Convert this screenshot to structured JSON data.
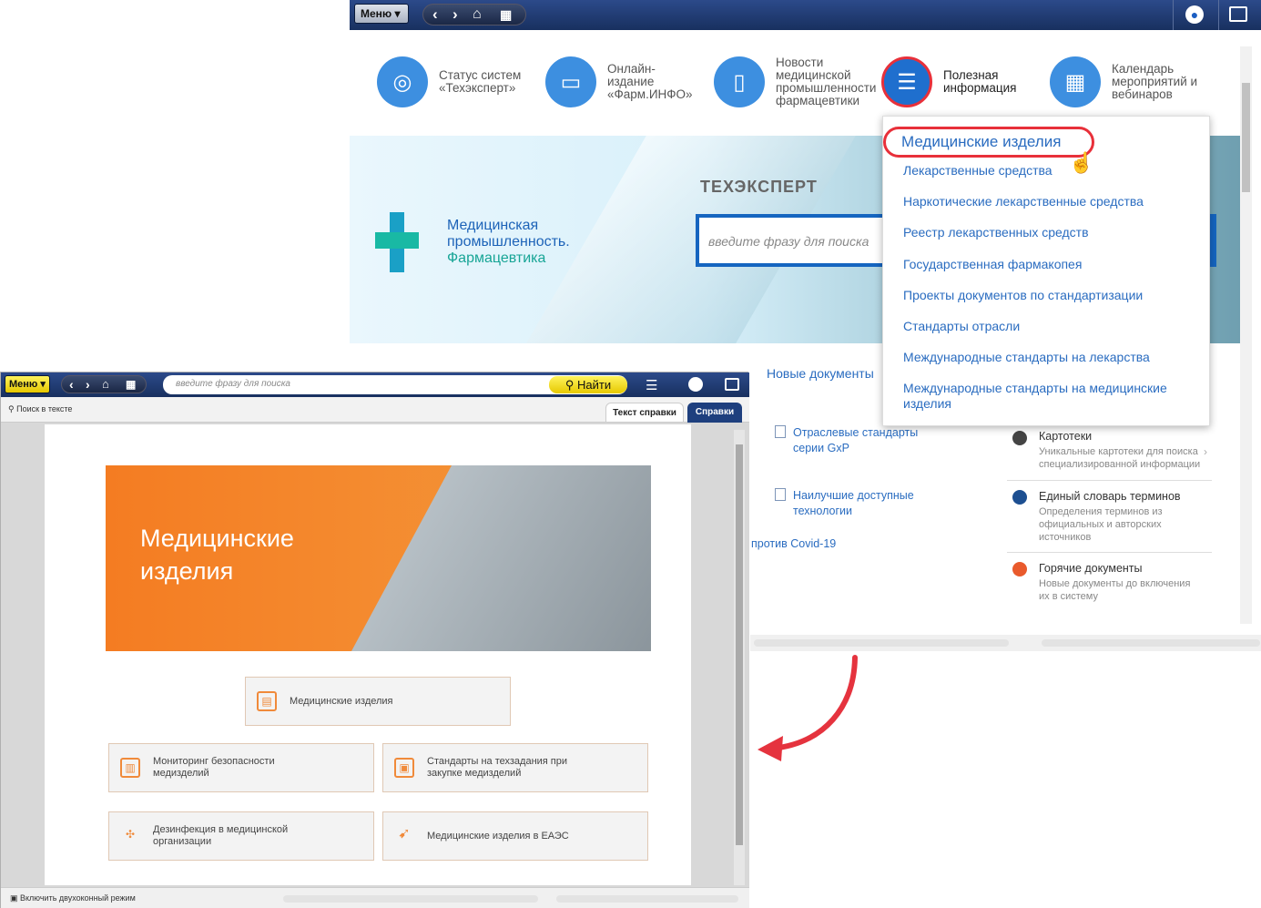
{
  "top_window": {
    "menu_label": "Меню",
    "nav_items": [
      {
        "label": "Статус систем «Техэксперт»",
        "icon": "rg-logo-icon"
      },
      {
        "label": "Онлайн-издание «Фарм.ИНФО»",
        "icon": "monitor-icon"
      },
      {
        "label": "Новости медицинской промышленности фармацевтики",
        "icon": "document-icon"
      },
      {
        "label": "Полезная информация",
        "icon": "info-list-icon"
      },
      {
        "label": "Календарь мероприятий и вебинаров",
        "icon": "calendar-icon"
      }
    ],
    "banner": {
      "title_line1": "Медицинская",
      "title_line2": "промышленность.",
      "title_line3": "Фармацевтика",
      "brand": "ТЕХЭКСПЕРТ",
      "search_placeholder": "введите фразу для поиска"
    },
    "dropdown_items": [
      "Медицинские изделия",
      "Лекарственные средства",
      "Наркотические лекарственные средства",
      "Реестр лекарственных средств",
      "Государственная фармакопея",
      "Проекты документов по стандартизации",
      "Стандарты отрасли",
      "Международные стандарты на лекарства",
      "Международные стандарты на медицинские изделия"
    ],
    "new_docs_label": "Новые документы",
    "doc_links": [
      "Отраслевые стандарты серии GxP",
      "Наилучшие доступные технологии"
    ],
    "covid_link": "против Covid-19",
    "side_items": [
      {
        "title": "Картотеки",
        "desc": "Уникальные картотеки для поиска специализированной информации"
      },
      {
        "title": "Единый словарь терминов",
        "desc": "Определения терминов из официальных и авторских источников"
      },
      {
        "title": "Горячие документы",
        "desc": "Новые документы до включения их в систему"
      }
    ]
  },
  "bottom_window": {
    "menu_label": "Меню",
    "search_placeholder": "введите фразу для поиска",
    "find_button": "Найти",
    "search_in_text": "Поиск в тексте",
    "tabs": [
      "Текст справки",
      "Справки"
    ],
    "hero_title_line1": "Медицинские",
    "hero_title_line2": "изделия",
    "tiles": [
      "Медицинские изделия",
      "Мониторинг безопасности медизделий",
      "Стандарты на техзадания при закупке медизделий",
      "Дезинфекция в медицинской организации",
      "Медицинские изделия в ЕАЭС"
    ],
    "status_text": "Включить двухоконный режим"
  },
  "colors": {
    "accent_blue": "#2a6cc0",
    "highlight_red": "#e8303a",
    "orange": "#f47c22",
    "yellow": "#f5dc20"
  }
}
